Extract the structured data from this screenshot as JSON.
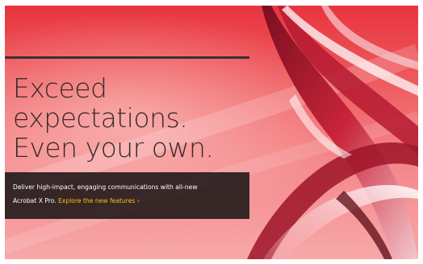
{
  "headline": {
    "line1": "Exceed",
    "line2": "expectations.",
    "line3": "Even your own."
  },
  "promo": {
    "line1": "Deliver high-impact, engaging communications with all-new",
    "line2_prefix": "Acrobat X Pro.",
    "cta_label": "Explore the new features ›"
  },
  "colors": {
    "banner_top": "#e8343f",
    "banner_bottom": "#f7a8a9",
    "headline_text": "#3a2a2a",
    "promo_background": "#1c1616",
    "cta_link": "#f5c21a"
  }
}
